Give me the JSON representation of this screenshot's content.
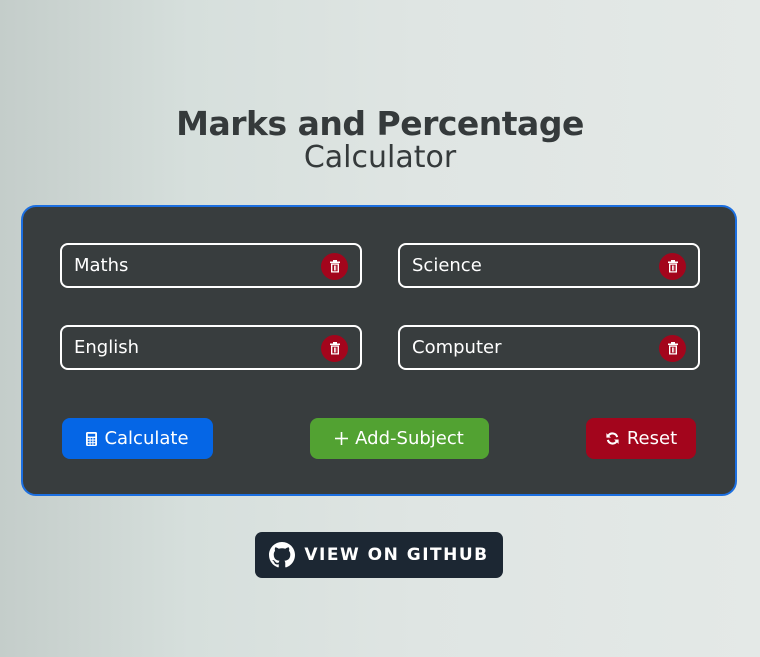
{
  "header": {
    "title": "Marks and Percentage",
    "subtitle": "Calculator"
  },
  "subjects": [
    {
      "value": "Maths",
      "delete_icon": "trash-icon"
    },
    {
      "value": "Science",
      "delete_icon": "trash-icon"
    },
    {
      "value": "English",
      "delete_icon": "trash-icon"
    },
    {
      "value": "Computer",
      "delete_icon": "trash-icon"
    }
  ],
  "actions": {
    "calculate": {
      "label": "Calculate",
      "icon": "calculator-icon",
      "color": "#0566e6"
    },
    "add_subject": {
      "label": "Add-Subject",
      "icon": "plus-icon",
      "color": "#52a232"
    },
    "reset": {
      "label": "Reset",
      "icon": "refresh-icon",
      "color": "#a3051c"
    }
  },
  "github": {
    "label": "VIEW ON GITHUB",
    "icon": "github-icon"
  },
  "colors": {
    "card_bg": "#383d3e",
    "card_border": "#1c6fe0",
    "delete": "#a3051c",
    "github_bg": "#1c2733",
    "text_dark": "#353a3b"
  }
}
